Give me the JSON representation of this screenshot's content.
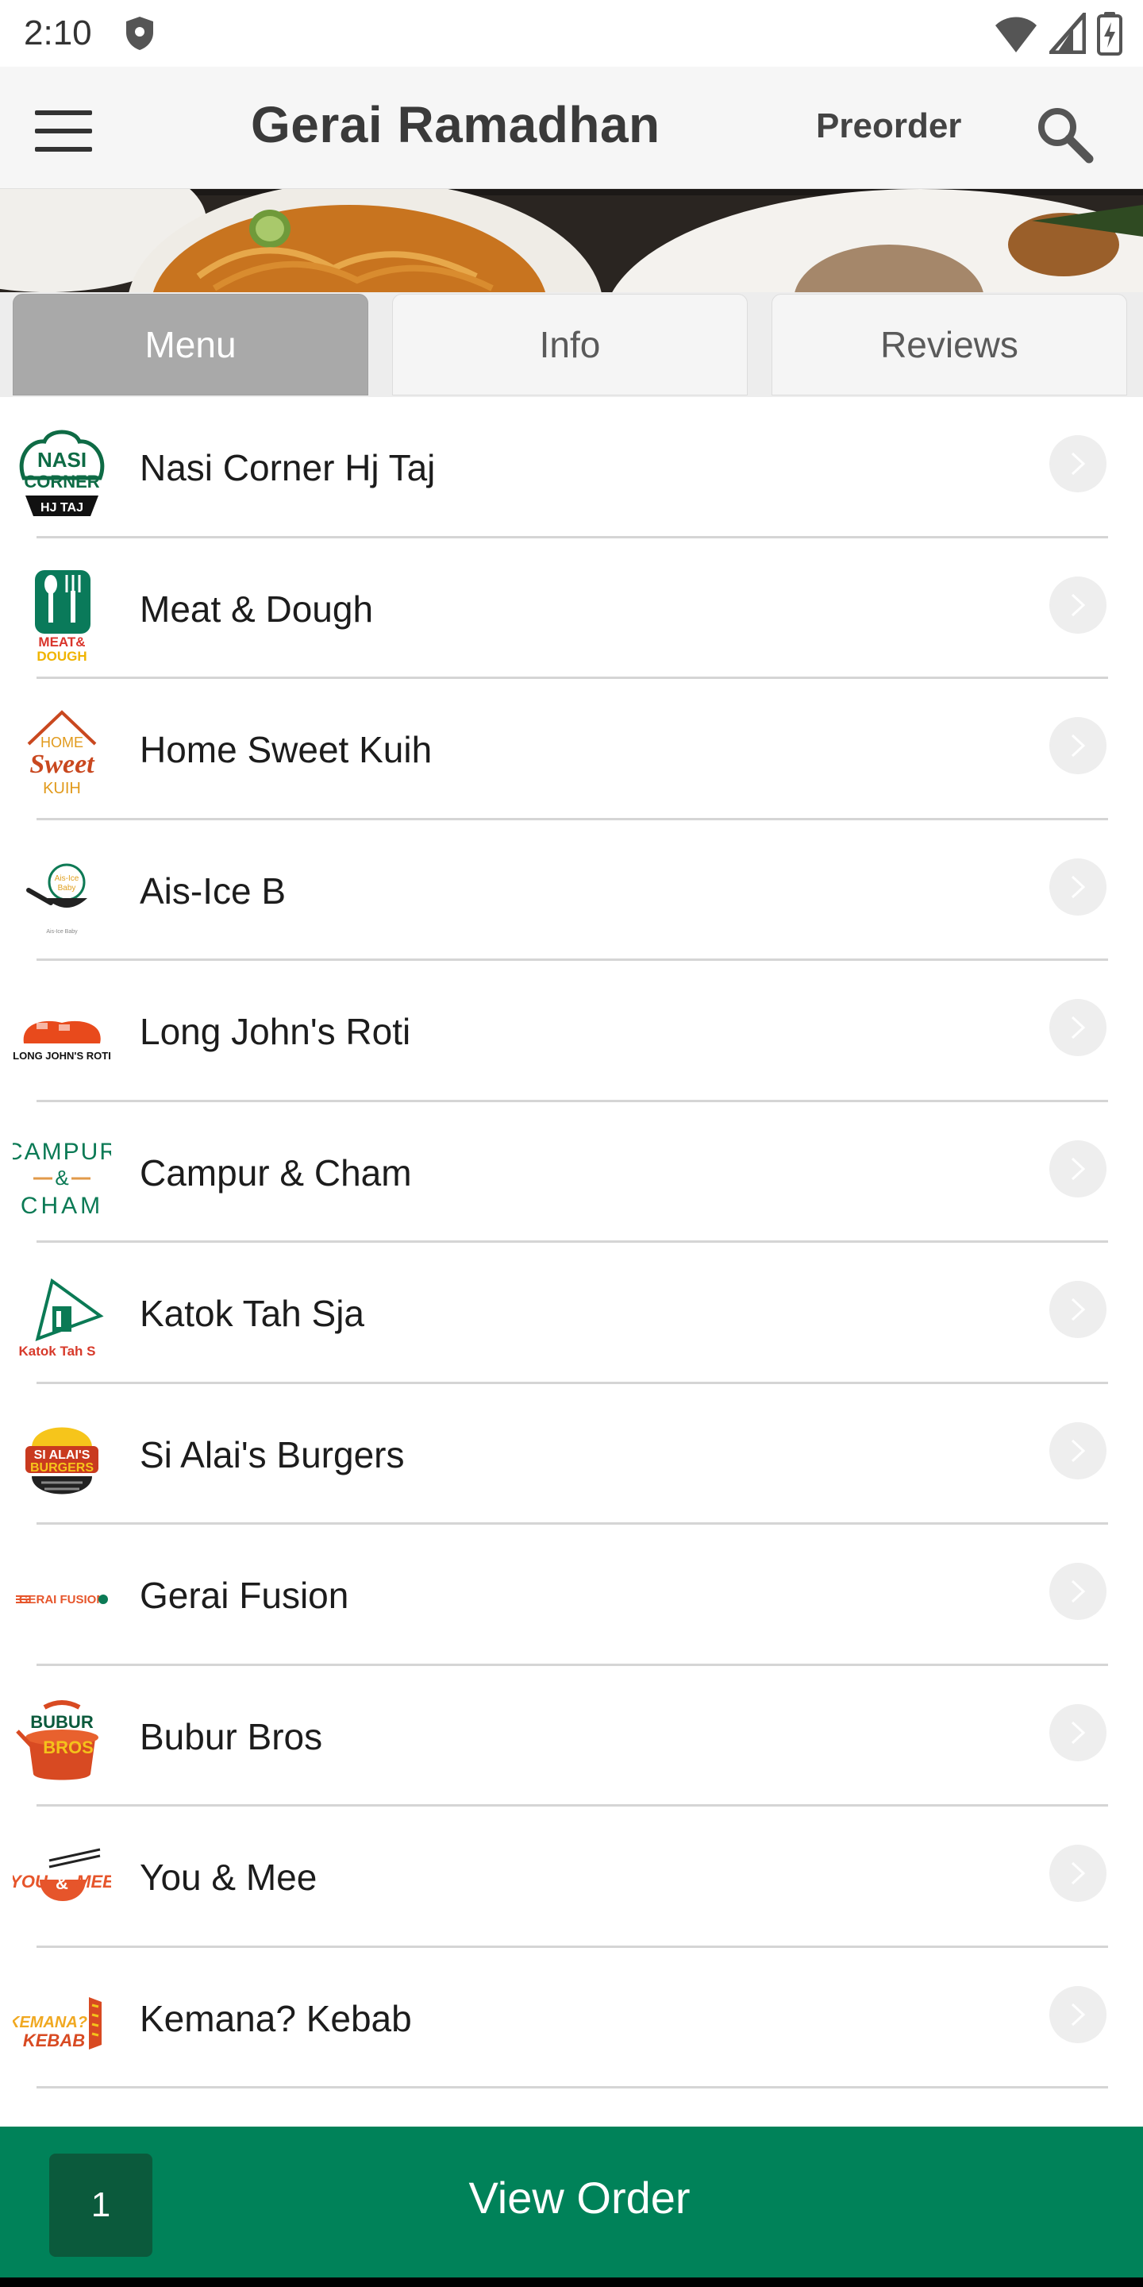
{
  "status_bar": {
    "time": "2:10"
  },
  "header": {
    "title": "Gerai Ramadhan",
    "preorder_label": "Preorder"
  },
  "tabs": [
    {
      "label": "Menu",
      "active": true
    },
    {
      "label": "Info",
      "active": false
    },
    {
      "label": "Reviews",
      "active": false
    }
  ],
  "stalls": [
    {
      "name": "Nasi Corner Hj Taj",
      "logo_text": "NASI CORNER HJ TAJ"
    },
    {
      "name": "Meat & Dough",
      "logo_text": "MEAT & DOUGH"
    },
    {
      "name": "Home Sweet Kuih",
      "logo_text": "HOME Sweet KUIH"
    },
    {
      "name": "Ais-Ice B",
      "logo_text": "Ais-Ice Baby"
    },
    {
      "name": "Long John's Roti",
      "logo_text": "LONG JOHN'S ROTI"
    },
    {
      "name": "Campur & Cham",
      "logo_text": "CAMPUR & CHAM"
    },
    {
      "name": "Katok Tah Sja",
      "logo_text": "Katok Tah Sja"
    },
    {
      "name": "Si Alai's Burgers",
      "logo_text": "SI ALAI'S BURGERS"
    },
    {
      "name": "Gerai Fusion",
      "logo_text": "GERAI FUSION"
    },
    {
      "name": "Bubur Bros",
      "logo_text": "BUBUR BROS"
    },
    {
      "name": "You & Mee",
      "logo_text": "YOU & MEE"
    },
    {
      "name": "Kemana? Kebab",
      "logo_text": "KEMANA? KEBAB"
    }
  ],
  "order_bar": {
    "count": "1",
    "label": "View Order"
  },
  "colors": {
    "accent": "#008259",
    "badge": "#0b5a3c",
    "tab_active": "#a9a9a9"
  }
}
